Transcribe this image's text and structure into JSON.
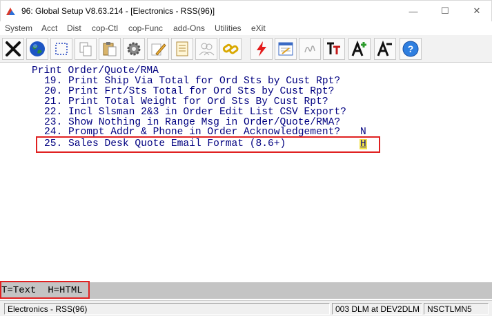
{
  "window": {
    "title": "96: Global Setup V8.63.214 - [Electronics - RSS(96)]",
    "minimize": "—",
    "maximize": "☐",
    "close": "✕"
  },
  "menu": [
    {
      "label": "System"
    },
    {
      "label": "Acct"
    },
    {
      "label": "Dist"
    },
    {
      "label": "cop-Ctl"
    },
    {
      "label": "cop-Func"
    },
    {
      "label": "add-Ons"
    },
    {
      "label": "Utilities"
    },
    {
      "label": "eXit"
    }
  ],
  "toolbar": [
    {
      "icon": "close-x-icon"
    },
    {
      "icon": "globe-icon"
    },
    {
      "icon": "select-rectangle-icon"
    },
    {
      "icon": "copy-icon"
    },
    {
      "icon": "paste-icon"
    },
    {
      "icon": "settings-gear-icon"
    },
    {
      "icon": "edit-pencil-icon"
    },
    {
      "icon": "notepad-icon"
    },
    {
      "icon": "users-icon"
    },
    {
      "icon": "chain-link-icon"
    },
    {
      "icon": "lightning-icon"
    },
    {
      "icon": "calendar-window-icon"
    },
    {
      "icon": "signature-icon"
    },
    {
      "icon": "font-tt-icon"
    },
    {
      "icon": "font-increase-icon"
    },
    {
      "icon": "font-decrease-icon"
    },
    {
      "icon": "help-icon"
    }
  ],
  "terminal": {
    "heading": "Print Order/Quote/RMA",
    "options": [
      {
        "num": "19.",
        "label": "Print Ship Via Total for Ord Sts by Cust Rpt?",
        "value": ""
      },
      {
        "num": "20.",
        "label": "Print Frt/Sts Total for Ord Sts by Cust Rpt?",
        "value": ""
      },
      {
        "num": "21.",
        "label": "Print Total Weight for Ord Sts By Cust Rpt?",
        "value": ""
      },
      {
        "num": "22.",
        "label": "Incl Slsman 2&3 in Order Edit List CSV Export?",
        "value": ""
      },
      {
        "num": "23.",
        "label": "Show Nothing in Range Msg in Order/Quote/RMA?",
        "value": ""
      },
      {
        "num": "24.",
        "label": "Prompt Addr & Phone in Order Acknowledgement?",
        "value": "N"
      },
      {
        "num": "25.",
        "label": "Sales Desk Quote Email Format (8.6+)",
        "value": "H"
      }
    ]
  },
  "hint": "T=Text  H=HTML",
  "status": {
    "company": "Electronics - RSS(96)",
    "session": "003 DLM at DEV2DLM",
    "terminal_id": "NSCTLMN5"
  }
}
